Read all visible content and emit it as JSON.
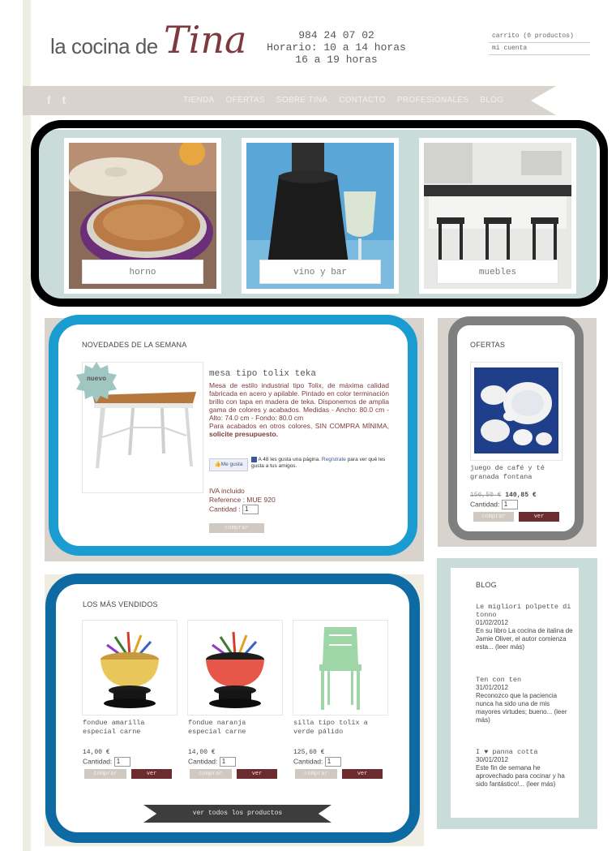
{
  "header": {
    "logo_prefix": "la cocina de",
    "logo_name": "Tina",
    "phone": "984 24 07 02",
    "hours_line1": "Horario: 10 a 14 horas",
    "hours_line2": "16 a 19 horas",
    "cart": "carrito (0 productos)",
    "account": "mi cuenta"
  },
  "nav": {
    "facebook": "f",
    "twitter": "t",
    "items": [
      "TIENDA",
      "OFERTAS",
      "SOBRE TINA",
      "CONTACTO",
      "PROFESIONALES",
      "BLOG"
    ]
  },
  "categories": [
    {
      "label": "horno"
    },
    {
      "label": "vino y bar"
    },
    {
      "label": "muebles"
    }
  ],
  "novedades": {
    "title": "NOVEDADES DE LA SEMANA",
    "badge": "nuevo",
    "product_name": "mesa tipo tolix teka",
    "description": "Mesa de estilo industrial tipo Tolix, de máxima calidad fabricada en acero y apilable. Pintado en color terminación brillo con tapa en madera de teka. Disponemos de amplia gama de colores y acabados. Medidas - Ancho: 80.0 cm - Alto: 74.0 cm - Fondo: 80.0 cm",
    "description2": "Para acabados en otros colores, SIN COMPRA MÍNIMA, ",
    "description2_bold": "solicite presupuesto.",
    "like_button": "Me gusta",
    "like_text_a": "A 48 les gusta una página. ",
    "like_link": "Regístrate",
    "like_text_b": " para ver qué les gusta a tus amigos.",
    "iva": "IVA incluido",
    "reference": "Reference : MUE 920",
    "quantity_label": "Cantidad :",
    "quantity": "1",
    "buy": "comprar"
  },
  "ofertas": {
    "title": "OFERTAS",
    "product_name": "juego de café y té granada fontana",
    "old_price": "156,50 €",
    "price": "140,85 €",
    "quantity_label": "Cantidad:",
    "quantity": "1",
    "buy": "comprar",
    "view": "ver"
  },
  "vendidos": {
    "title": "LOS MÁS VENDIDOS",
    "items": [
      {
        "name": "fondue amarilla especial carne",
        "price": "14,00 €",
        "quantity_label": "Cantidad:",
        "quantity": "1",
        "buy": "comprar",
        "view": "ver",
        "color": "#e9c65a"
      },
      {
        "name": "fondue naranja especial carne",
        "price": "14,00 €",
        "quantity_label": "Cantidad:",
        "quantity": "1",
        "buy": "comprar",
        "view": "ver",
        "color": "#e6574a"
      },
      {
        "name": "silla tipo tolix a verde pálido",
        "price": "125,60 €",
        "quantity_label": "Cantidad:",
        "quantity": "1",
        "buy": "comprar",
        "view": "ver",
        "color": "#9fd6a8"
      }
    ],
    "see_all": "ver todos los productos"
  },
  "blog": {
    "title": "BLOG",
    "entries": [
      {
        "title": "Le migliori polpette di tonno",
        "date": "01/02/2012",
        "body": "En su libro La cocina de italina de Jamie Oliver, el autor comienza esta... (leer más)"
      },
      {
        "title": "Ten con ten",
        "date": "31/01/2012",
        "body": "Reconozco que la paciencia nunca ha sido una de mis mayores virtudes; bueno... (leer más)"
      },
      {
        "title": "I ♥ panna cotta",
        "date": "30/01/2012",
        "body": "Este fin de semana he aprovechado para cocinar y ha sido fantástico!... (leer más)"
      }
    ]
  },
  "colors": {
    "brand": "#7d3a3e",
    "nav_bg": "#d8d3cd",
    "mint": "#c9dcd9",
    "highlight_black": "#000000",
    "highlight_light_blue": "#1a9cd0",
    "highlight_dark_blue": "#0e6aa3",
    "highlight_gray": "#7f7f7f"
  }
}
